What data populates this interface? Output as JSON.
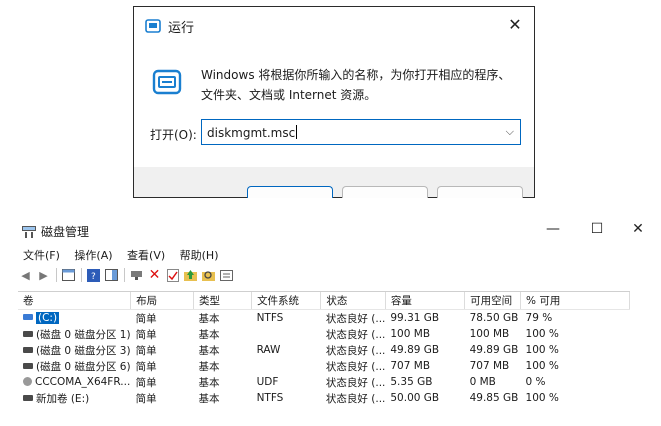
{
  "run_dialog": {
    "title": "运行",
    "description": "Windows 将根据你所输入的名称，为你打开相应的程序、文件夹、文档或 Internet 资源。",
    "open_label": "打开(O):",
    "input_value": "diskmgmt.msc",
    "accent": "#0067c0"
  },
  "disk_mgmt": {
    "title": "磁盘管理",
    "menu": [
      "文件(F)",
      "操作(A)",
      "查看(V)",
      "帮助(H)"
    ],
    "columns": [
      "卷",
      "布局",
      "类型",
      "文件系统",
      "状态",
      "容量",
      "可用空间",
      "% 可用"
    ],
    "rows": [
      {
        "vol": "(C:)",
        "layout": "简单",
        "type": "基本",
        "fs": "NTFS",
        "status": "状态良好 (...",
        "capacity": "99.31 GB",
        "free": "78.50 GB",
        "pct": "79 %",
        "icon": "volume-icon",
        "selected": true
      },
      {
        "vol": "(磁盘 0 磁盘分区 1)",
        "layout": "简单",
        "type": "基本",
        "fs": "",
        "status": "状态良好 (...",
        "capacity": "100 MB",
        "free": "100 MB",
        "pct": "100 %",
        "icon": "volume-icon"
      },
      {
        "vol": "(磁盘 0 磁盘分区 3)",
        "layout": "简单",
        "type": "基本",
        "fs": "RAW",
        "status": "状态良好 (...",
        "capacity": "49.89 GB",
        "free": "49.89 GB",
        "pct": "100 %",
        "icon": "volume-icon"
      },
      {
        "vol": "(磁盘 0 磁盘分区 6)",
        "layout": "简单",
        "type": "基本",
        "fs": "",
        "status": "状态良好 (...",
        "capacity": "707 MB",
        "free": "707 MB",
        "pct": "100 %",
        "icon": "volume-icon"
      },
      {
        "vol": "CCCOMA_X64FR...",
        "layout": "简单",
        "type": "基本",
        "fs": "UDF",
        "status": "状态良好 (...",
        "capacity": "5.35 GB",
        "free": "0 MB",
        "pct": "0 %",
        "icon": "cd-icon"
      },
      {
        "vol": "新加卷 (E:)",
        "layout": "简单",
        "type": "基本",
        "fs": "NTFS",
        "status": "状态良好 (...",
        "capacity": "50.00 GB",
        "free": "49.85 GB",
        "pct": "100 %",
        "icon": "volume-icon"
      }
    ]
  }
}
